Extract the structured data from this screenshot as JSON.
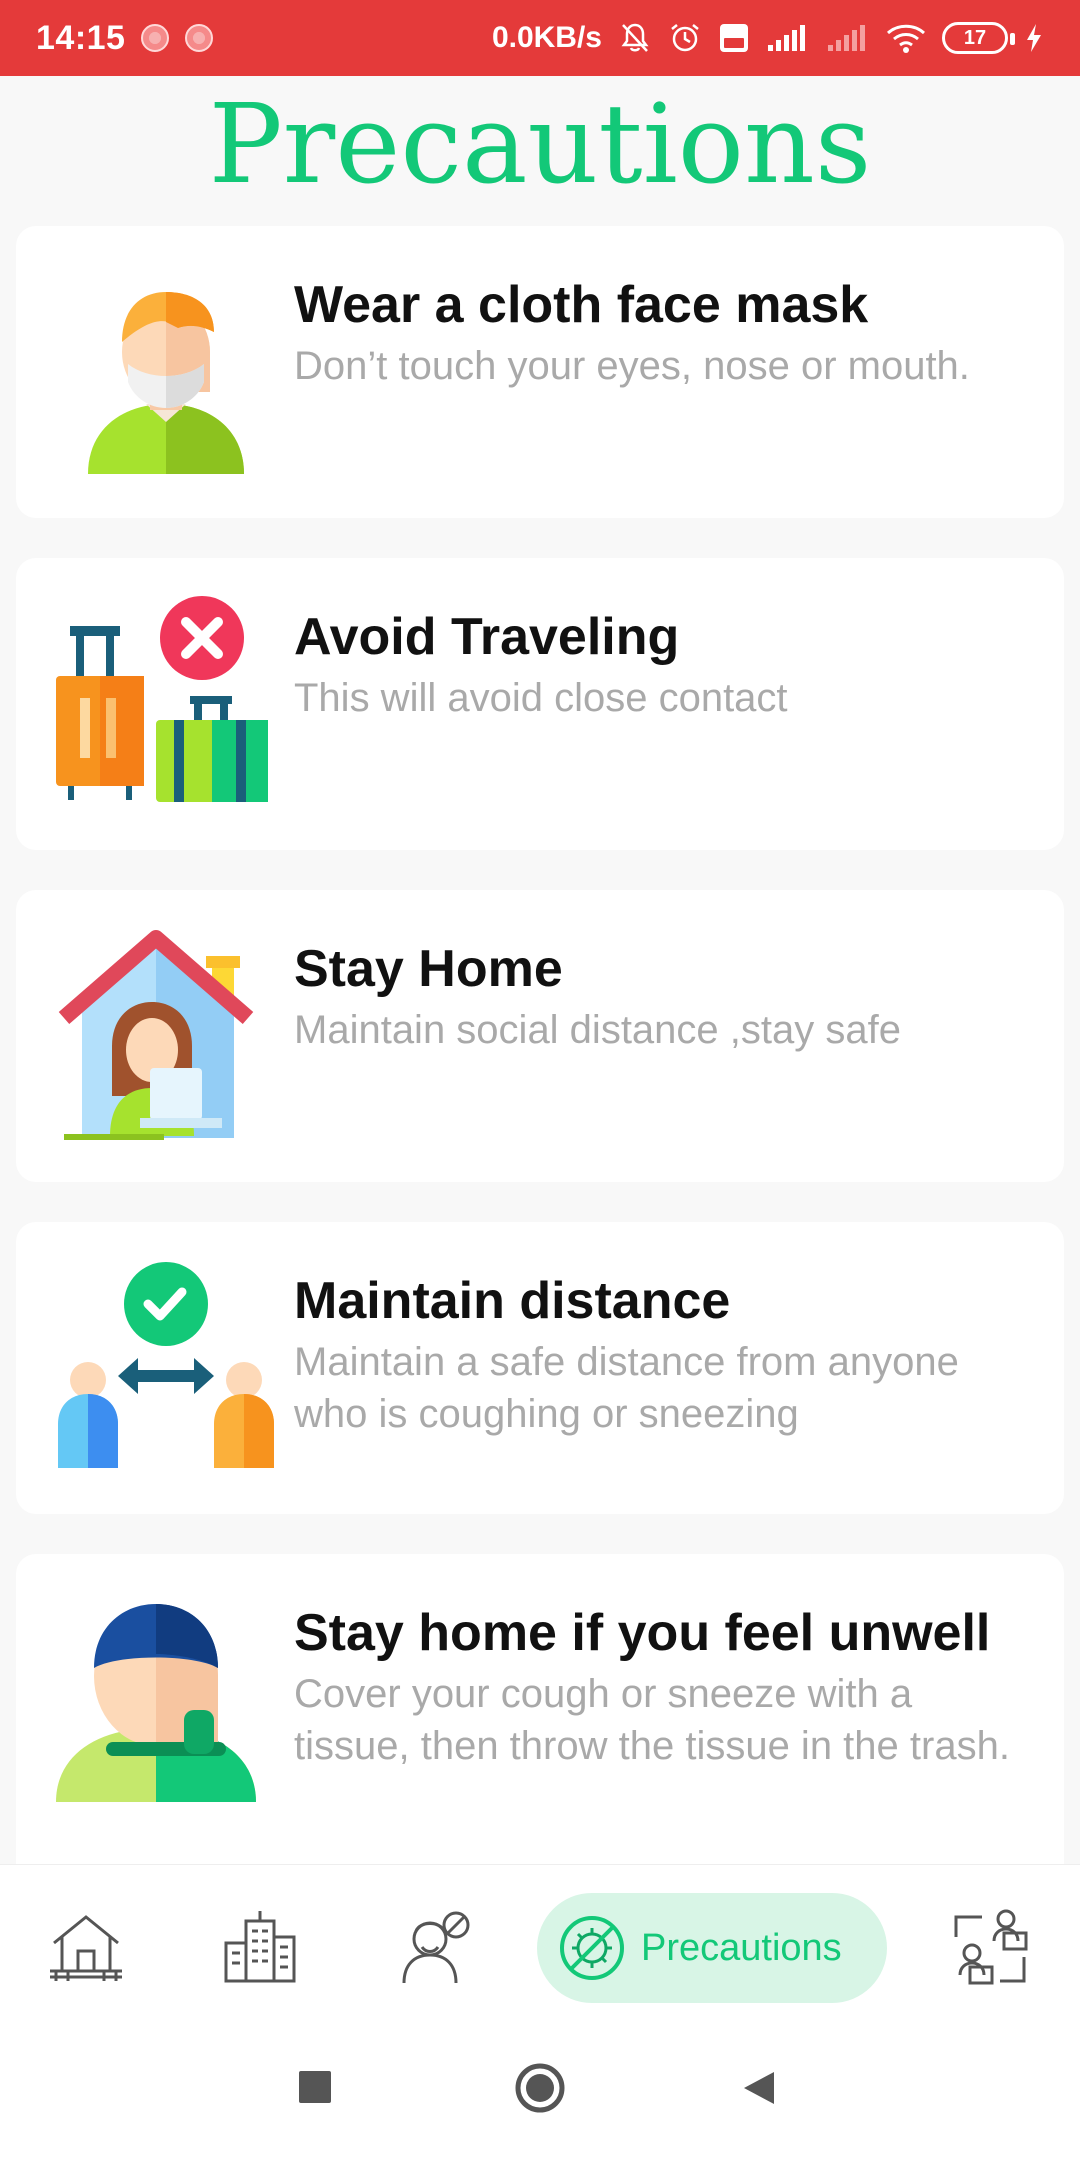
{
  "status_bar": {
    "time": "14:15",
    "network_speed": "0.0KB/s",
    "battery_level": "17"
  },
  "page": {
    "title": "Precautions"
  },
  "cards": [
    {
      "title": "Wear a cloth face mask",
      "description": "Don’t touch your eyes, nose or mouth.",
      "icon": "masked-person-icon"
    },
    {
      "title": "Avoid Traveling",
      "description": "This will avoid close contact",
      "icon": "no-travel-luggage-icon"
    },
    {
      "title": "Stay Home",
      "description": "Maintain social distance ,stay safe",
      "icon": "stay-home-icon"
    },
    {
      "title": "Maintain distance",
      "description": "Maintain a safe distance from anyone who is coughing or sneezing",
      "icon": "social-distance-icon"
    },
    {
      "title": "Stay home if you feel unwell",
      "description": "Cover your cough or sneeze with a tissue, then throw the tissue in the trash.",
      "icon": "cough-person-icon"
    }
  ],
  "bottom_nav": {
    "items": [
      {
        "icon": "home-icon",
        "active": false
      },
      {
        "icon": "city-buildings-icon",
        "active": false
      },
      {
        "icon": "doctor-icon",
        "active": false
      },
      {
        "icon": "virus-icon",
        "label": "Precautions",
        "active": true
      },
      {
        "icon": "remote-work-icon",
        "active": false
      }
    ]
  },
  "system_nav": {
    "items": [
      "recents-button",
      "home-button",
      "back-button"
    ]
  },
  "colors": {
    "status_bar": "#e43a3a",
    "accent": "#13c878",
    "active_nav_bg": "#d8f5e6",
    "title_text": "#111111",
    "description_text": "#a9a9a9"
  }
}
